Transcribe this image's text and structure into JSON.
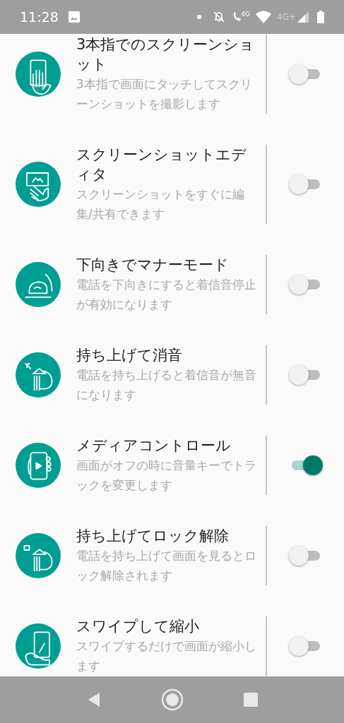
{
  "status_bar": {
    "time": "11:28",
    "call_network": "4G",
    "data_network": "4G+"
  },
  "settings": [
    {
      "title": "3本指でのスクリーンショット",
      "description": "3本指で画面にタッチしてスクリーンショットを撮影します",
      "on": false
    },
    {
      "title": "スクリーンショットエディタ",
      "description": "スクリーンショットをすぐに編集/共有できます",
      "on": false
    },
    {
      "title": "下向きでマナーモード",
      "description": "電話を下向きにすると着信音停止が有効になります",
      "on": false
    },
    {
      "title": "持ち上げて消音",
      "description": "電話を持ち上げると着信音が無音になります",
      "on": false
    },
    {
      "title": "メディアコントロール",
      "description": "画面がオフの時に音量キーでトラックを変更します",
      "on": true
    },
    {
      "title": "持ち上げてロック解除",
      "description": "電話を持ち上げて画面を見るとロック解除されます",
      "on": false
    },
    {
      "title": "スワイプして縮小",
      "description": "スワイプするだけで画面が縮小します",
      "on": false
    }
  ]
}
